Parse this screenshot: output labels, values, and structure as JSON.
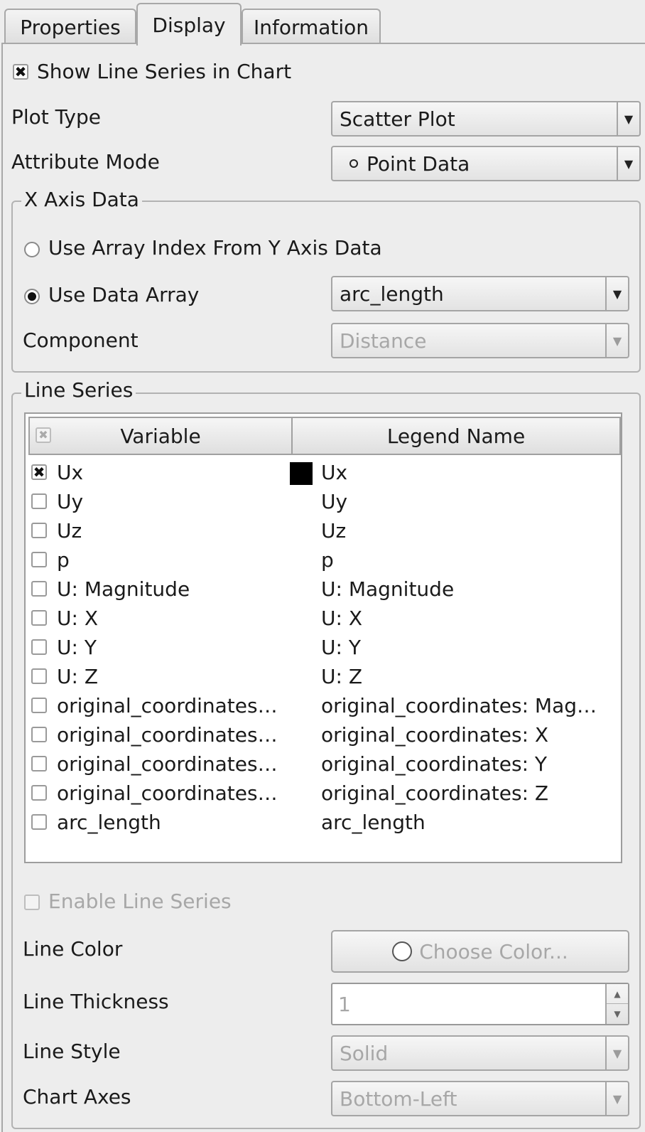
{
  "tabs": [
    {
      "label": "Properties",
      "active": false
    },
    {
      "label": "Display",
      "active": true
    },
    {
      "label": "Information",
      "active": false
    }
  ],
  "show_line_series": {
    "label": "Show Line Series in Chart",
    "checked": true
  },
  "plot_type": {
    "label": "Plot Type",
    "value": "Scatter Plot"
  },
  "attribute_mode": {
    "label": "Attribute Mode",
    "value": "Point Data",
    "icon": "point-data-icon"
  },
  "x_axis": {
    "title": "X Axis Data",
    "use_index_label": "Use Array Index From Y Axis Data",
    "use_array_label": "Use Data Array",
    "selected": "use_array",
    "array_value": "arc_length",
    "component_label": "Component",
    "component_value": "Distance"
  },
  "line_series": {
    "title": "Line Series",
    "headers": {
      "variable": "Variable",
      "legend": "Legend Name"
    },
    "rows": [
      {
        "variable": "Ux",
        "legend": "Ux",
        "checked": true,
        "color": "#000000"
      },
      {
        "variable": "Uy",
        "legend": "Uy",
        "checked": false
      },
      {
        "variable": "Uz",
        "legend": "Uz",
        "checked": false
      },
      {
        "variable": "p",
        "legend": "p",
        "checked": false
      },
      {
        "variable": "U: Magnitude",
        "legend": "U: Magnitude",
        "checked": false
      },
      {
        "variable": "U: X",
        "legend": "U: X",
        "checked": false
      },
      {
        "variable": "U: Y",
        "legend": "U: Y",
        "checked": false
      },
      {
        "variable": "U: Z",
        "legend": "U: Z",
        "checked": false
      },
      {
        "variable": "original_coordinates…",
        "legend": "original_coordinates: Mag…",
        "checked": false
      },
      {
        "variable": "original_coordinates: X",
        "legend": "original_coordinates: X",
        "checked": false
      },
      {
        "variable": "original_coordinates: Y",
        "legend": "original_coordinates: Y",
        "checked": false
      },
      {
        "variable": "original_coordinates: Z",
        "legend": "original_coordinates: Z",
        "checked": false
      },
      {
        "variable": "arc_length",
        "legend": "arc_length",
        "checked": false
      }
    ],
    "enable_label": "Enable Line Series",
    "line_color_label": "Line Color",
    "choose_color_label": "Choose Color...",
    "line_thickness_label": "Line Thickness",
    "line_thickness_value": "1",
    "line_style_label": "Line Style",
    "line_style_value": "Solid",
    "chart_axes_label": "Chart Axes",
    "chart_axes_value": "Bottom-Left"
  }
}
